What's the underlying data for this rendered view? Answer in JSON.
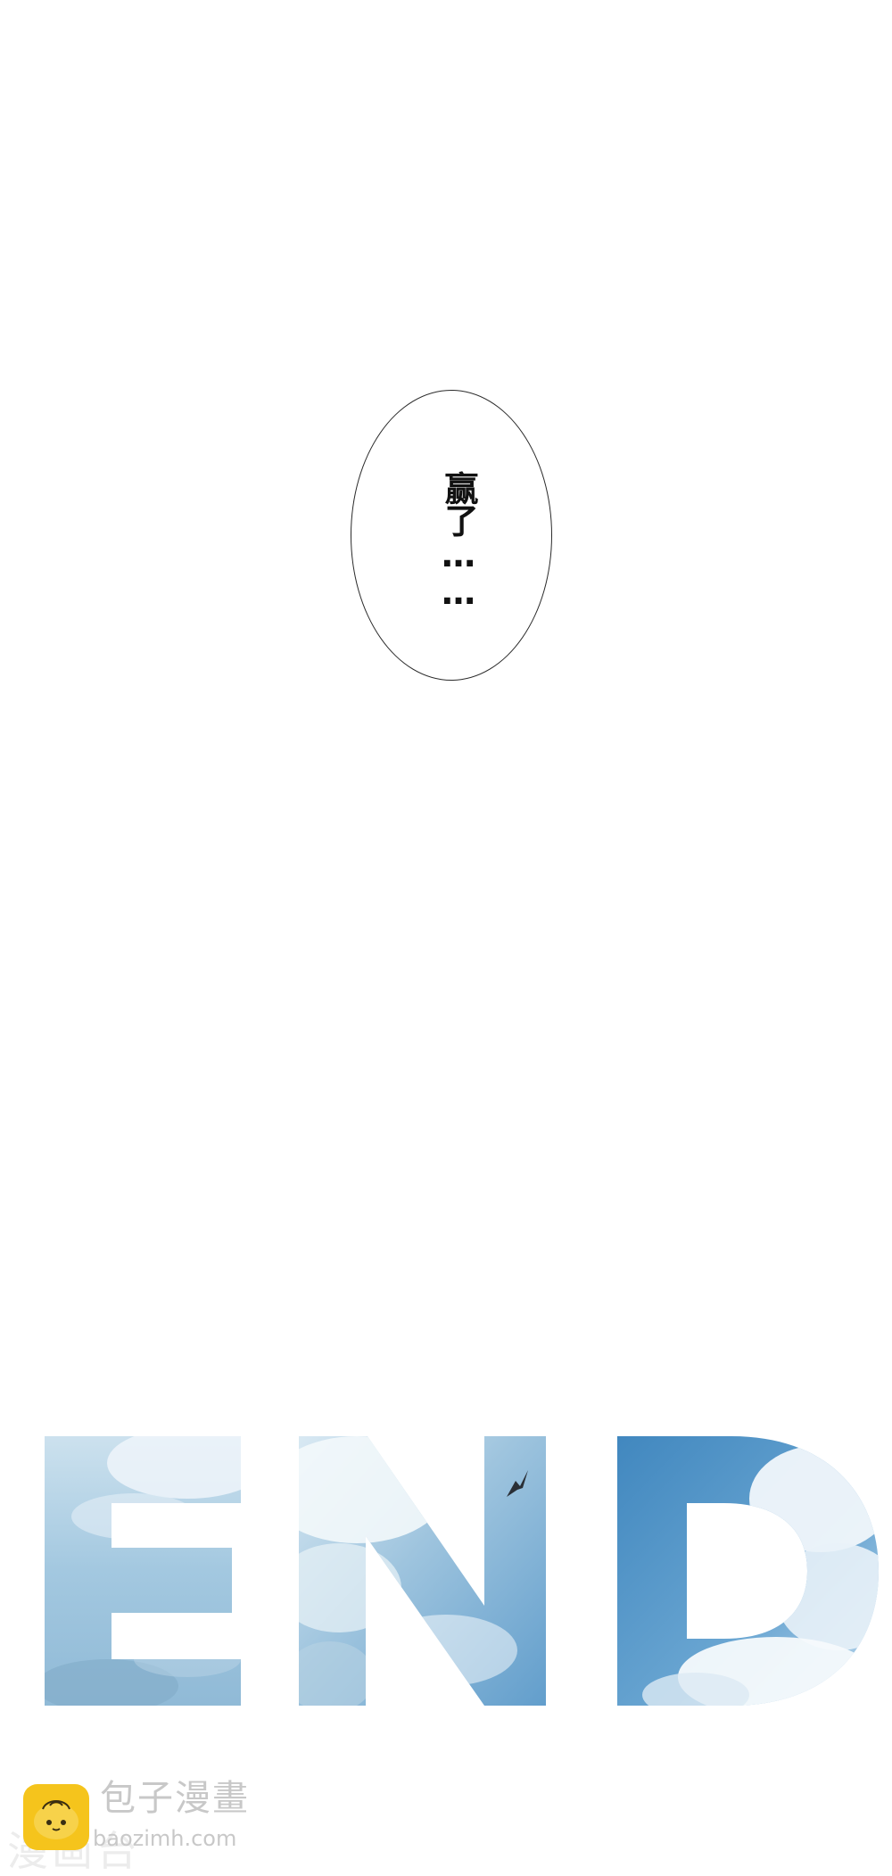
{
  "bubble": {
    "text": "赢了……"
  },
  "end_title": {
    "text": "END"
  },
  "watermark": {
    "site_name_cn": "包子漫畫",
    "url": "baozimh.com",
    "ghost_text": "漫画台"
  },
  "colors": {
    "sky_light": "#c9dfec",
    "sky_mid": "#8fbbd9",
    "sky_deep": "#4c8fc2",
    "cloud_white": "#f4f8fb",
    "logo_yellow": "#f5c41c",
    "bubble_outline": "#2a2a2a"
  }
}
